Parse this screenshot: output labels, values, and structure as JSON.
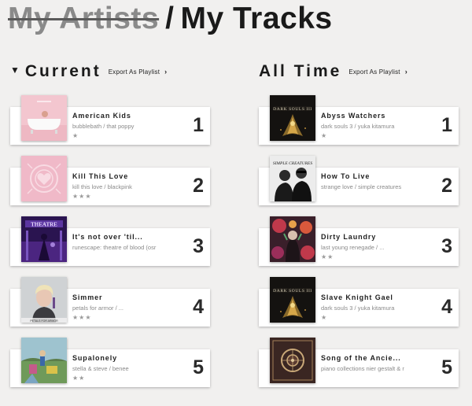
{
  "header": {
    "struck": "My Artists",
    "separator": "/",
    "title": "My Tracks"
  },
  "columns": [
    {
      "title": "Current",
      "export_label": "Export As Playlist",
      "tracks": [
        {
          "rank": "1",
          "name": "American Kids",
          "sub": "bubblebath / that poppy",
          "stars": "★",
          "art": "pink-bathtub"
        },
        {
          "rank": "2",
          "name": "Kill This Love",
          "sub": "kill this love / blackpink",
          "stars": "★★★",
          "art": "pink-heart-emblem"
        },
        {
          "rank": "3",
          "name": "It's not over 'til...",
          "sub": "runescape: theatre of blood (osr",
          "stars": "",
          "art": "purple-theatre"
        },
        {
          "rank": "4",
          "name": "Simmer",
          "sub": "petals for armor / ...",
          "stars": "★★★",
          "art": "portrait-blond"
        },
        {
          "rank": "5",
          "name": "Supalonely",
          "sub": "stella & steve / benee",
          "stars": "★★",
          "art": "outdoor-scene"
        }
      ]
    },
    {
      "title": "All Time",
      "export_label": "Export As Playlist",
      "tracks": [
        {
          "rank": "1",
          "name": "Abyss Watchers",
          "sub": "dark souls 3 / yuka kitamura",
          "stars": "★",
          "art": "dark-souls-gold"
        },
        {
          "rank": "2",
          "name": "How To Live",
          "sub": "strange love / simple creatures",
          "stars": "",
          "art": "bw-duo"
        },
        {
          "rank": "3",
          "name": "Dirty Laundry",
          "sub": "last young renegade / ...",
          "stars": "★★",
          "art": "floral-renegade"
        },
        {
          "rank": "4",
          "name": "Slave Knight Gael",
          "sub": "dark souls 3 / yuka kitamura",
          "stars": "★",
          "art": "dark-souls-gold"
        },
        {
          "rank": "5",
          "name": "Song of the Ancie...",
          "sub": "piano collections nier gestalt & r",
          "stars": "",
          "art": "nier-ornate"
        }
      ]
    }
  ]
}
